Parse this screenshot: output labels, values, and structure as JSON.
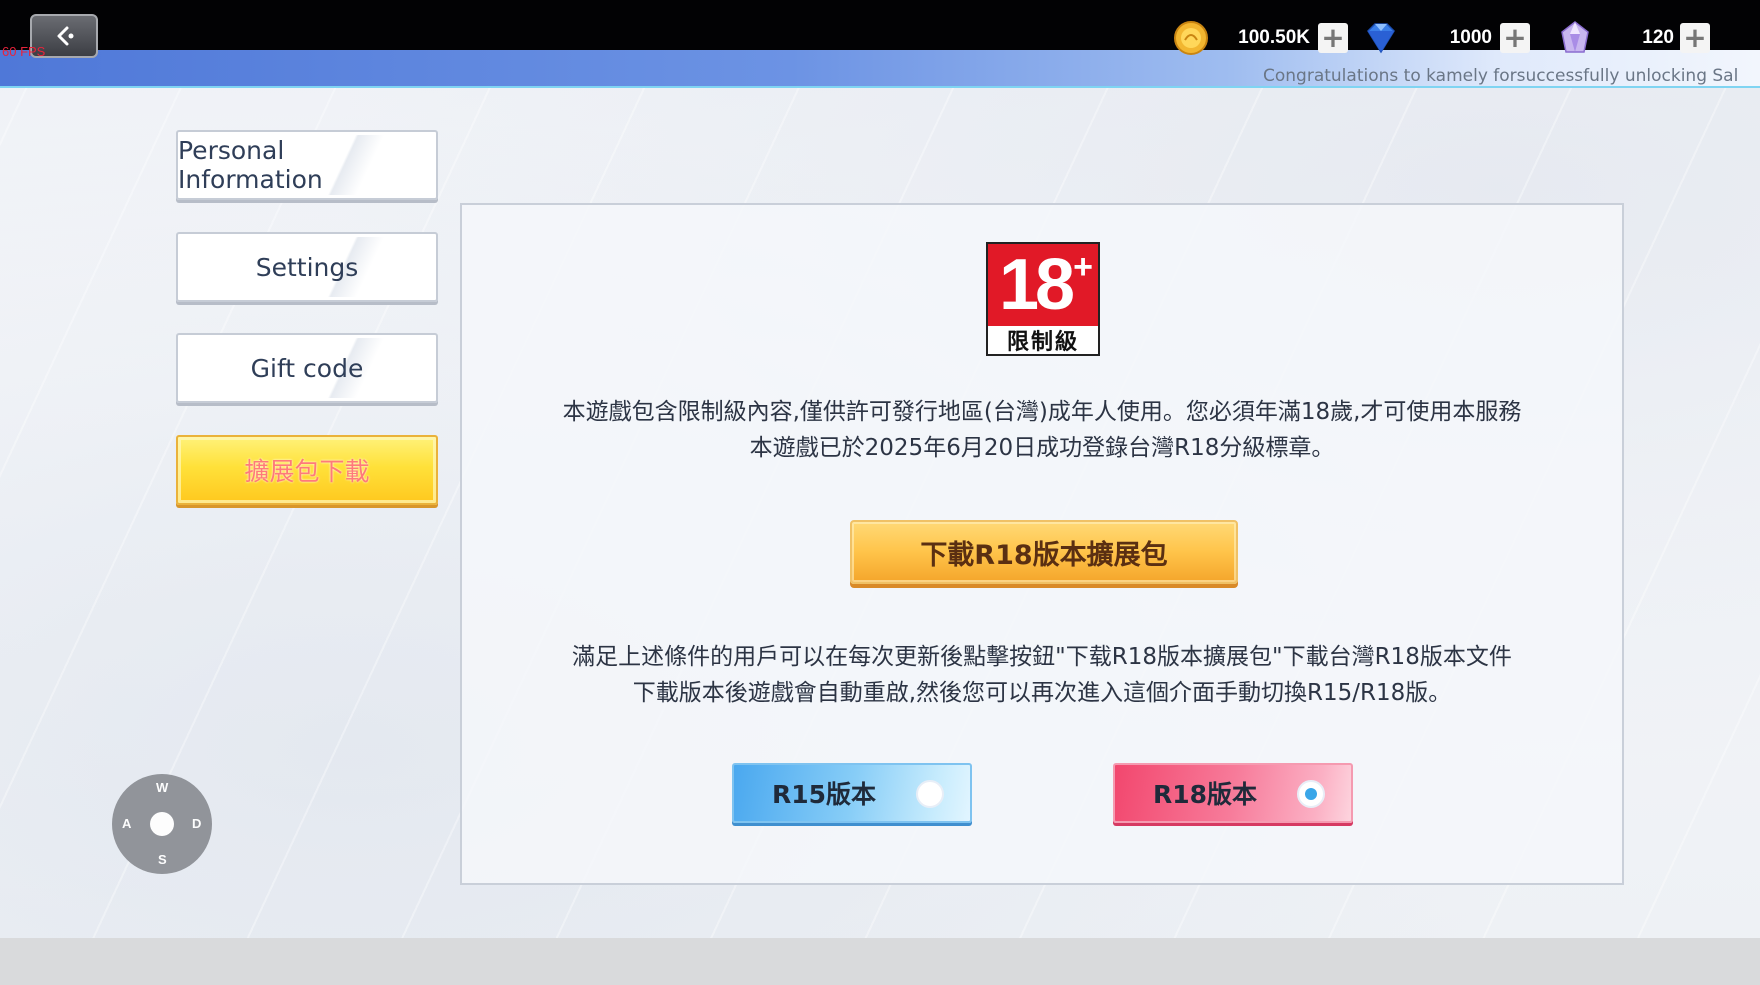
{
  "hud": {
    "fps": "60 FPS",
    "gold_value": "100.50K",
    "gem_value": "1000",
    "crystal_value": "120",
    "plus_glyph": "+",
    "ticker": "Congratulations to kamely forsuccessfully unlocking Sal"
  },
  "sidebar": {
    "items": [
      {
        "label": "Personal Information"
      },
      {
        "label": "Settings"
      },
      {
        "label": "Gift code"
      },
      {
        "label": "擴展包下載"
      }
    ]
  },
  "panel": {
    "rating": {
      "number": "18",
      "plus": "+",
      "text": "限制級"
    },
    "notice_line1": "本遊戲包含限制級內容,僅供許可發行地區(台灣)成年人使用。您必須年滿18歲,才可使用本服務",
    "notice_line2": "本遊戲已於2025年6月20日成功登錄台灣R18分級標章。",
    "download_button": "下載R18版本擴展包",
    "info_line1": "滿足上述條件的用戶可以在每次更新後點擊按鈕\"下载R18版本擴展包\"下載台灣R18版本文件",
    "info_line2": "下載版本後遊戲會自動重啟,然後您可以再次進入這個介面手動切換R15/R18版。",
    "versions": [
      {
        "label": "R15版本",
        "selected": false
      },
      {
        "label": "R18版本",
        "selected": true
      }
    ]
  },
  "joystick": {
    "up": "W",
    "left": "A",
    "right": "D",
    "down": "S"
  },
  "colors": {
    "accent_yellow": "#ffe13a",
    "r15_blue": "#4aa8ef",
    "r18_pink": "#f2476e",
    "rating_red": "#e11927"
  }
}
